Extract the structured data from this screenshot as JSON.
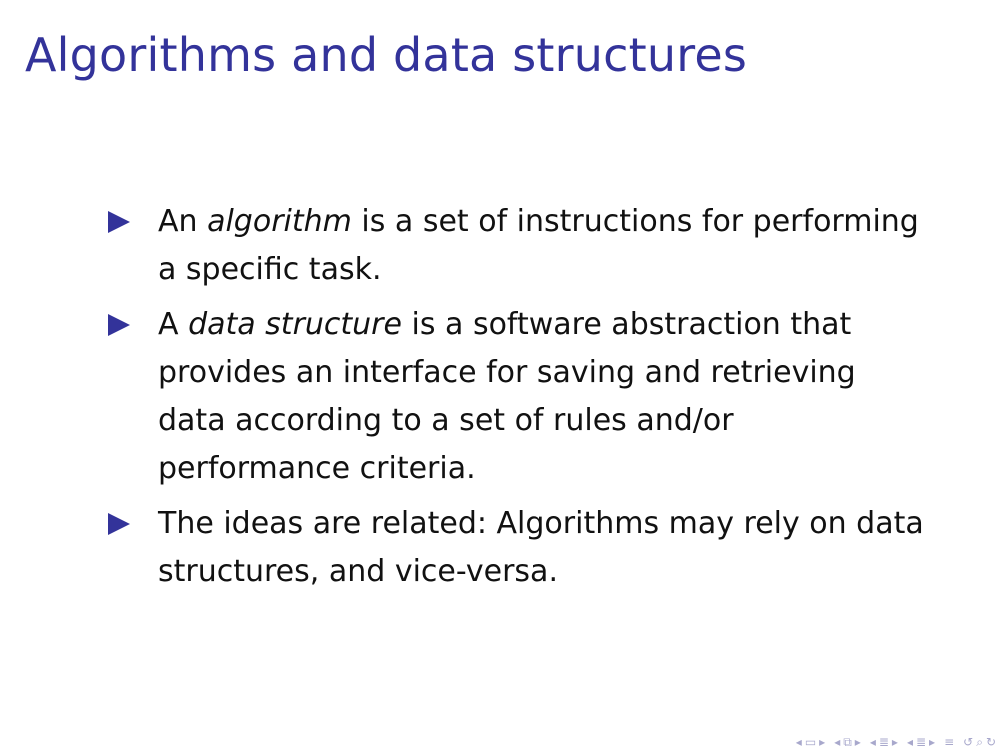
{
  "slide": {
    "title": "Algorithms and data structures",
    "bullets": [
      {
        "parts": [
          {
            "text": "An ",
            "emphasis": false
          },
          {
            "text": "algorithm",
            "emphasis": true
          },
          {
            "text": " is a set of instructions for performing a specific task.",
            "emphasis": false
          }
        ]
      },
      {
        "parts": [
          {
            "text": "A ",
            "emphasis": false
          },
          {
            "text": "data structure",
            "emphasis": true
          },
          {
            "text": " is a software abstraction that provides an interface for saving and retrieving data according to a set of rules and/or performance criteria.",
            "emphasis": false
          }
        ]
      },
      {
        "parts": [
          {
            "text": "The ideas are related: Algorithms may rely on data structures, and vice-versa.",
            "emphasis": false
          }
        ]
      }
    ]
  },
  "colors": {
    "title": "#33339a",
    "bullet_marker": "#33339a",
    "body_text": "#111111",
    "nav_icons": "#a8a8cc"
  },
  "navigation": {
    "icons": [
      "nav-prev-arrow-icon",
      "nav-frame-icon",
      "nav-next-arrow-icon",
      "nav-prev-arrow-icon",
      "nav-subsection-icon",
      "nav-next-arrow-icon",
      "nav-prev-arrow-icon",
      "nav-section-icon",
      "nav-next-arrow-icon",
      "nav-prev-arrow-icon",
      "nav-section-icon",
      "nav-next-arrow-icon",
      "nav-align-icon",
      "nav-undo-icon",
      "nav-search-icon"
    ]
  }
}
